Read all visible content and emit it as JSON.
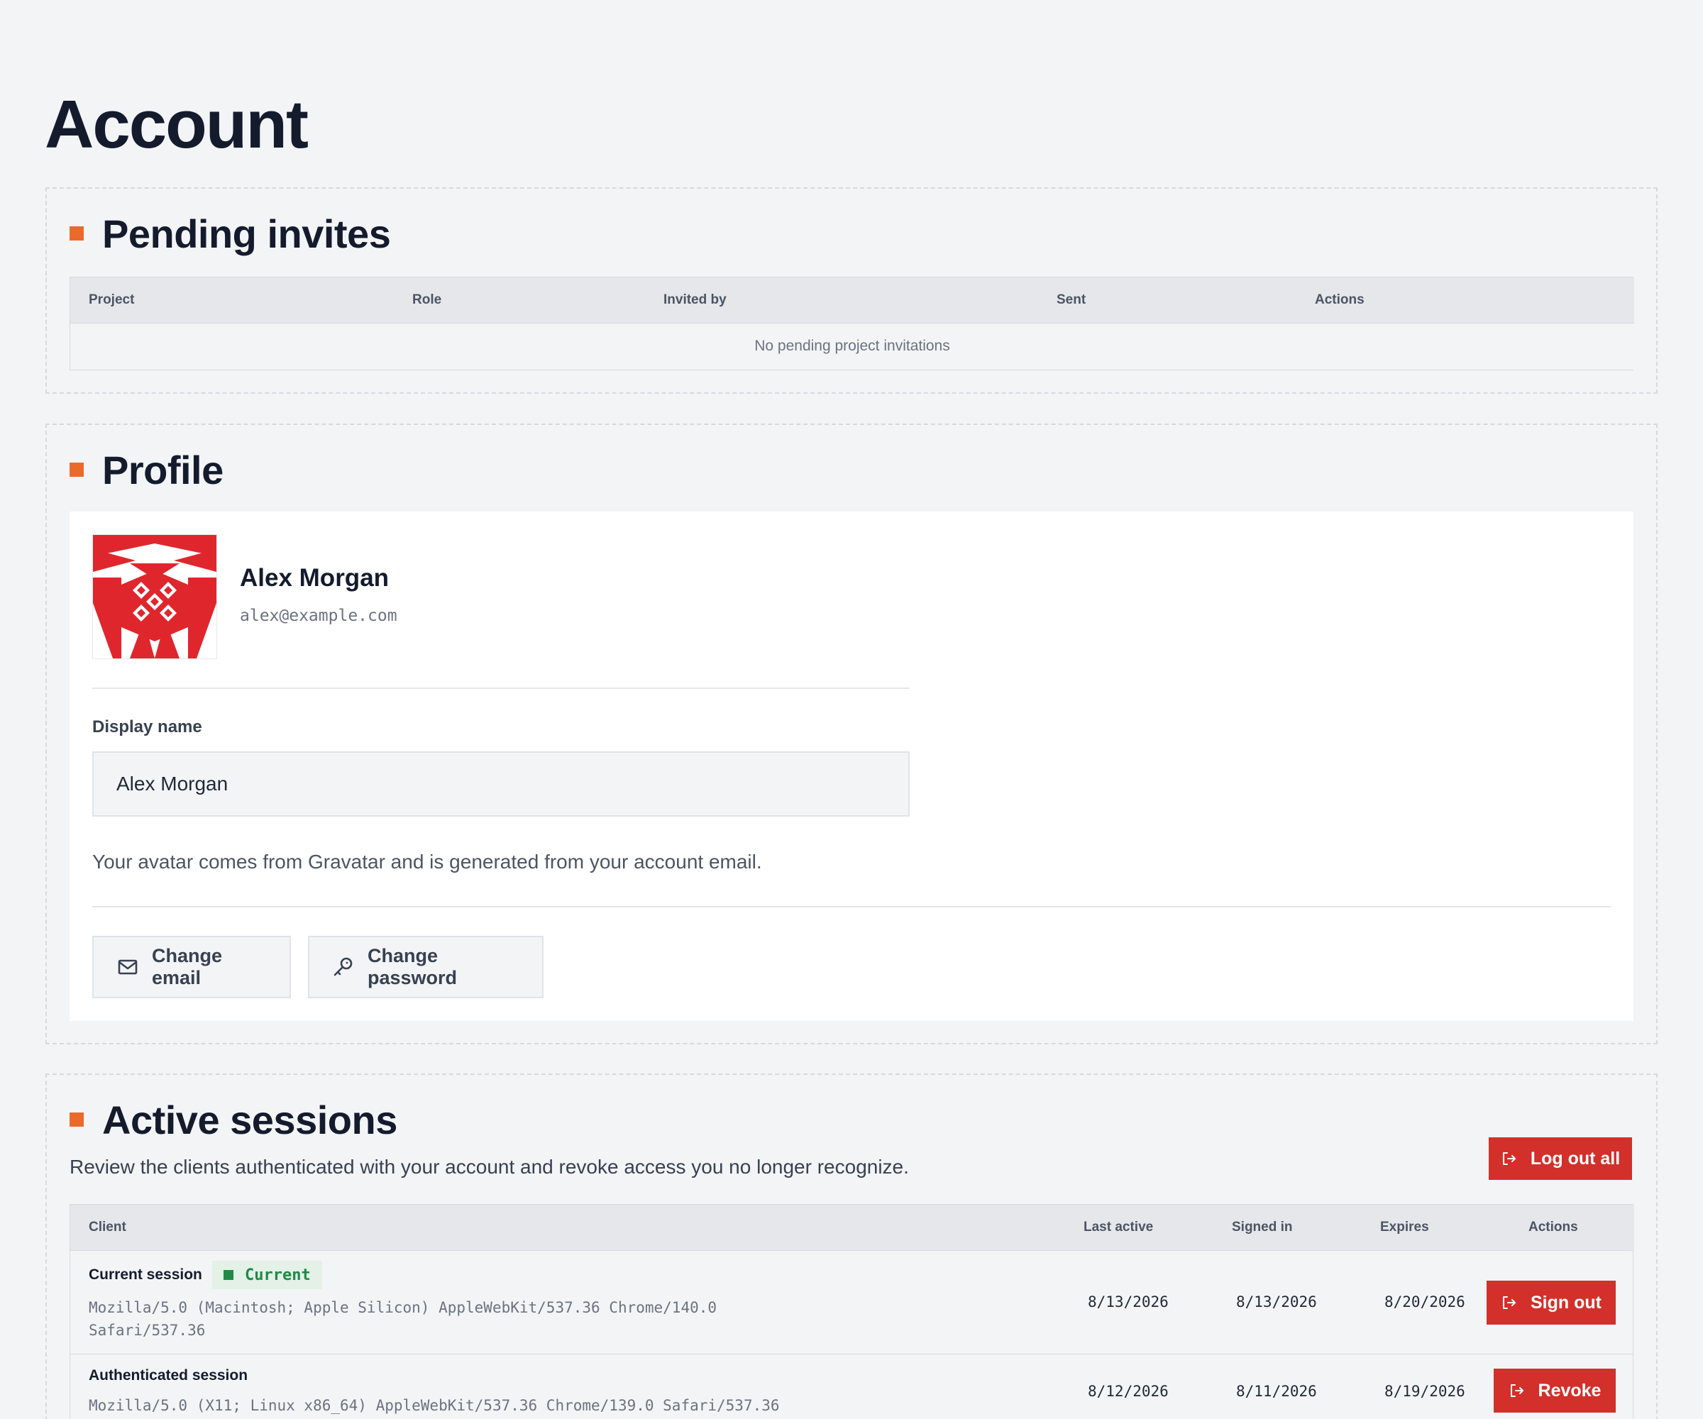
{
  "page": {
    "title": "Account"
  },
  "pending_invites": {
    "title": "Pending invites",
    "columns": [
      "Project",
      "Role",
      "Invited by",
      "Sent",
      "Actions"
    ],
    "empty_text": "No pending project invitations"
  },
  "profile": {
    "title": "Profile",
    "name": "Alex Morgan",
    "email": "alex@example.com",
    "display_name_label": "Display name",
    "display_name_value": "Alex Morgan",
    "avatar_help": "Your avatar comes from Gravatar and is generated from your account email.",
    "change_email_label": "Change email",
    "change_password_label": "Change password"
  },
  "sessions": {
    "title": "Active sessions",
    "description": "Review the clients authenticated with your account and revoke access you no longer recognize.",
    "logout_all_label": "Log out all",
    "columns": [
      "Client",
      "Last active",
      "Signed in",
      "Expires",
      "Actions"
    ],
    "rows": [
      {
        "name": "Current session",
        "badge": "Current",
        "ua_line1": "Mozilla/5.0 (Macintosh; Apple Silicon) AppleWebKit/537.36 Chrome/140.0",
        "ua_line2": "Safari/537.36",
        "last_active": "8/13/2026",
        "signed_in": "8/13/2026",
        "expires": "8/20/2026",
        "action": "Sign out"
      },
      {
        "name": "Authenticated session",
        "ua_line1": "Mozilla/5.0 (X11; Linux x86_64) AppleWebKit/537.36 Chrome/139.0 Safari/537.36",
        "last_active": "8/12/2026",
        "signed_in": "8/11/2026",
        "expires": "8/19/2026",
        "action": "Revoke"
      }
    ]
  },
  "colors": {
    "accent": "#ea6a2a",
    "danger": "#d3302b",
    "success": "#1f8a46",
    "avatar": "#e0262d"
  },
  "icons": {
    "section_marker": "square-marker-icon",
    "change_email": "mail-icon",
    "change_password": "key-icon",
    "logout": "logout-icon",
    "badge": "square-dot-icon"
  }
}
